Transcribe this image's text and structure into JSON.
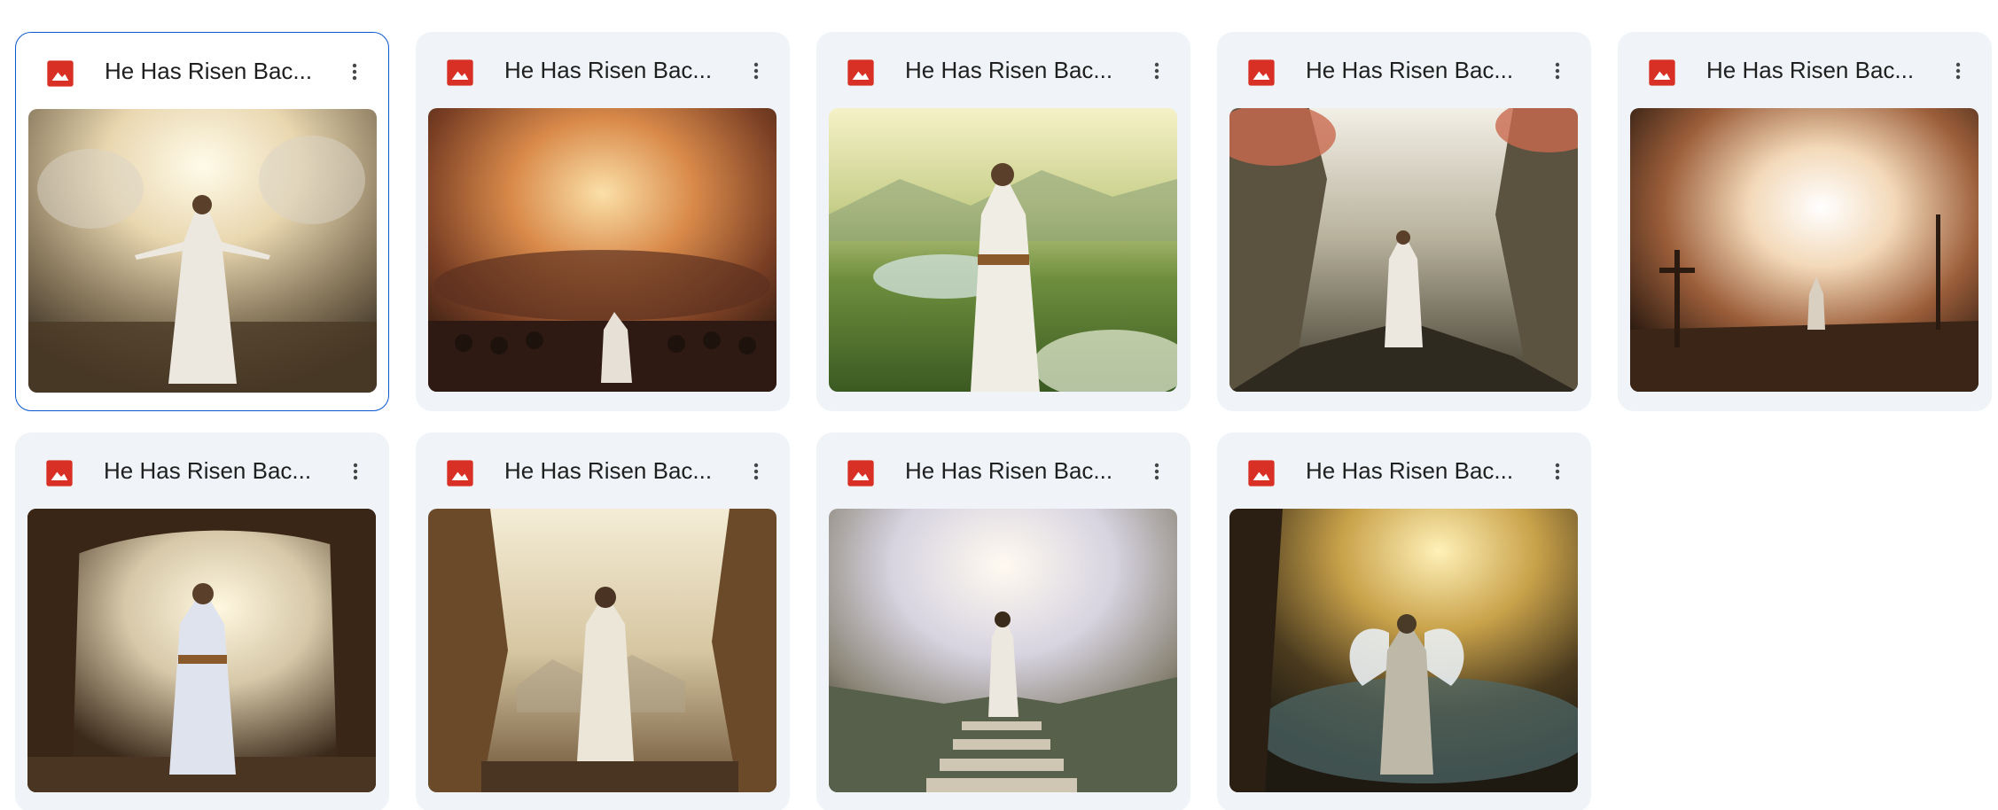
{
  "colors": {
    "accent": "#0b57d0",
    "card_bg": "#f0f4f9",
    "image_icon": "#d93025"
  },
  "files": [
    {
      "name": "He Has Risen Bac...",
      "icon": "image-file-icon",
      "selected": true,
      "scene": "radiant-sky-crowd"
    },
    {
      "name": "He Has Risen Bac...",
      "icon": "image-file-icon",
      "selected": false,
      "scene": "stormy-red-sky-crowd"
    },
    {
      "name": "He Has Risen Bac...",
      "icon": "image-file-icon",
      "selected": false,
      "scene": "green-valley-river"
    },
    {
      "name": "He Has Risen Bac...",
      "icon": "image-file-icon",
      "selected": false,
      "scene": "autumn-valley-path"
    },
    {
      "name": "He Has Risen Bac...",
      "icon": "image-file-icon",
      "selected": false,
      "scene": "glowing-storm-crosses"
    },
    {
      "name": "He Has Risen Bac...",
      "icon": "image-file-icon",
      "selected": false,
      "scene": "cave-light"
    },
    {
      "name": "He Has Risen Bac...",
      "icon": "image-file-icon",
      "selected": false,
      "scene": "tomb-entrance-desert"
    },
    {
      "name": "He Has Risen Bac...",
      "icon": "image-file-icon",
      "selected": false,
      "scene": "stone-steps-heaven"
    },
    {
      "name": "He Has Risen Bac...",
      "icon": "image-file-icon",
      "selected": false,
      "scene": "angel-wings-pond"
    }
  ]
}
